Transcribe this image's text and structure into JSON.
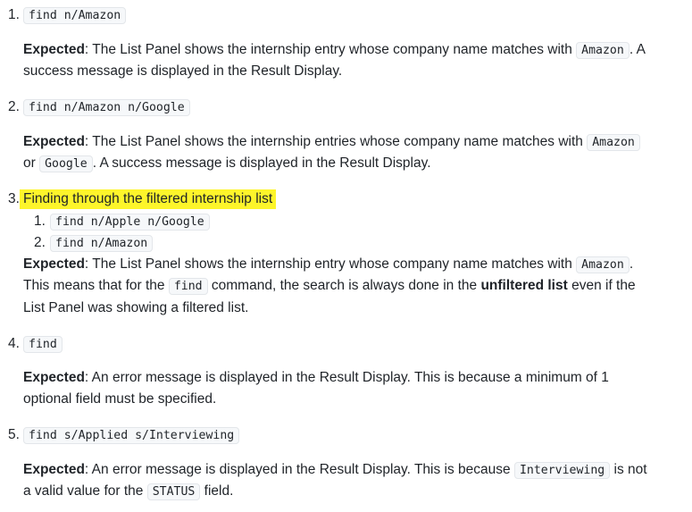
{
  "items": [
    {
      "number": "1.",
      "command": "find n/Amazon",
      "expected_label": "Expected",
      "line1_pre": ": The List Panel shows the internship entry whose company name matches with ",
      "line1_code": "Amazon",
      "line1_post": ". A",
      "line2": "success message is displayed in the Result Display."
    },
    {
      "number": "2.",
      "command": "find n/Amazon n/Google",
      "expected_label": "Expected",
      "line1_pre": ": The List Panel shows the internship entries whose company name matches with ",
      "line1_code": "Amazon",
      "line2_pre": "or ",
      "line2_code": "Google",
      "line2_post": ". A success message is displayed in the Result Display."
    },
    {
      "number": "3.",
      "title": "Finding through the filtered internship list",
      "sub_items": [
        {
          "number": "1.",
          "command": "find n/Apple n/Google"
        },
        {
          "number": "2.",
          "command": "find n/Amazon"
        }
      ],
      "expected_label": "Expected",
      "line1_pre": ": The List Panel shows the internship entry whose company name matches with ",
      "line1_code": "Amazon",
      "line1_post": ".",
      "line2_pre": "This means that for the ",
      "line2_code": "find",
      "line2_mid": " command, the search is always done in the ",
      "line2_bold": "unfiltered list",
      "line2_post": " even if the",
      "line3": "List Panel was showing a filtered list."
    },
    {
      "number": "4.",
      "command": "find",
      "expected_label": "Expected",
      "line1": ": An error message is displayed in the Result Display. This is because a minimum of 1",
      "line2": "optional field must be specified."
    },
    {
      "number": "5.",
      "command": "find s/Applied s/Interviewing",
      "expected_label": "Expected",
      "line1_pre": ": An error message is displayed in the Result Display. This is because ",
      "line1_code": "Interviewing",
      "line1_post": " is not",
      "line2_pre": "a valid value for the ",
      "line2_code": "STATUS",
      "line2_post": " field."
    }
  ],
  "colors": {
    "highlight": "#fdf52b",
    "code_bg": "#f6f8fa",
    "text": "#1f2328"
  }
}
